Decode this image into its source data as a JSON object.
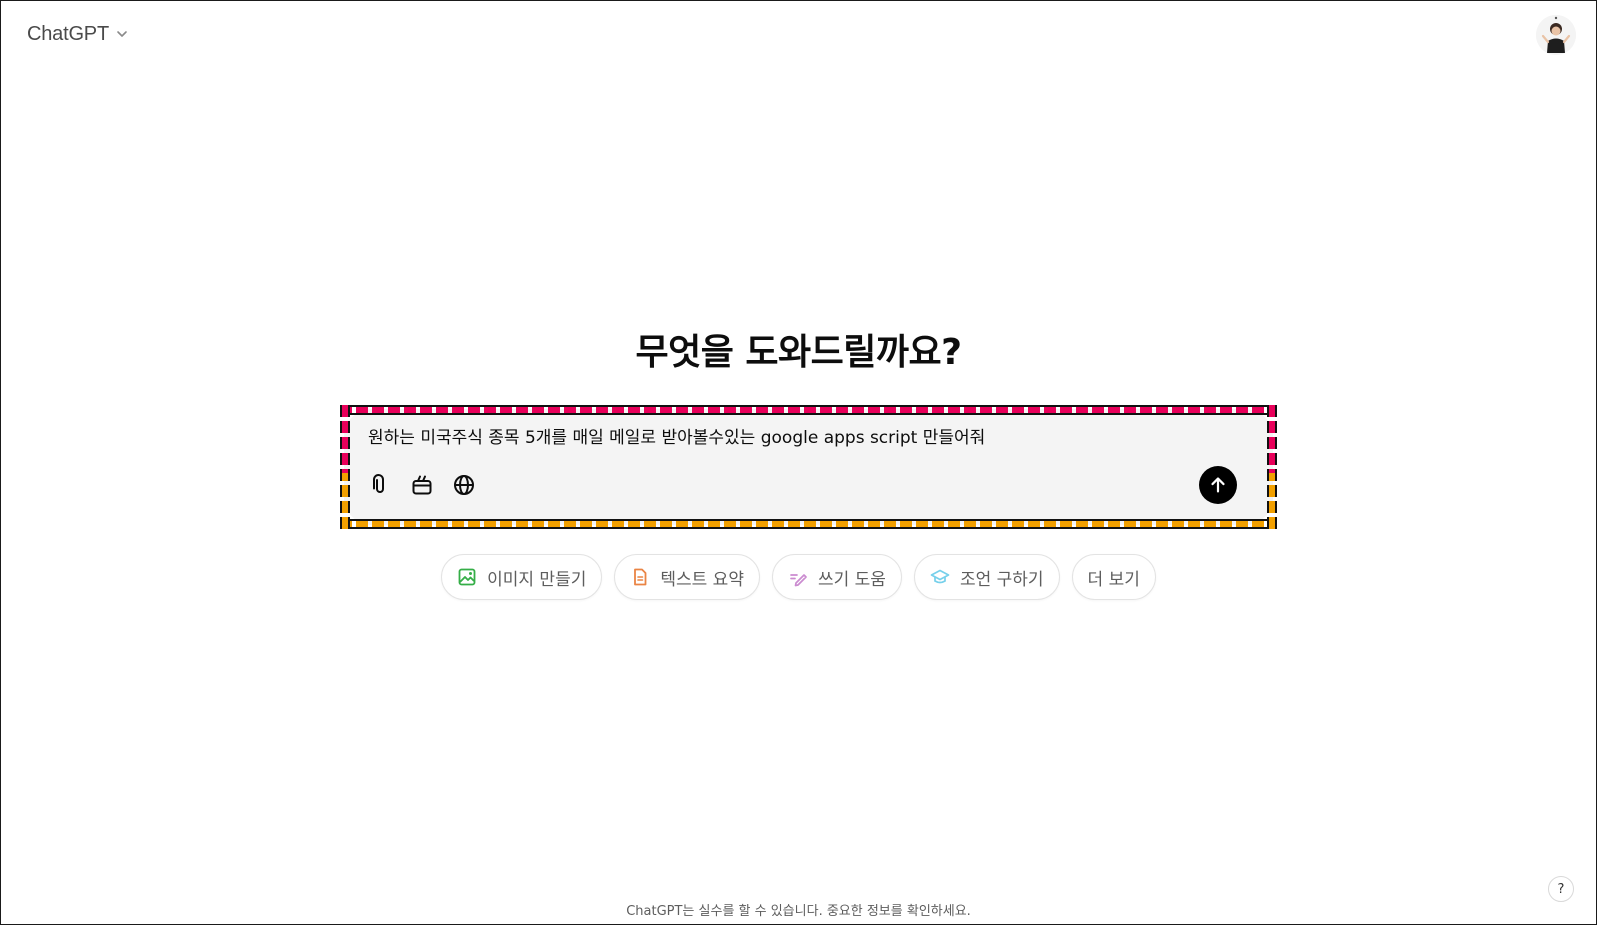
{
  "header": {
    "model_name": "ChatGPT",
    "model_switcher_icon": "chevron-down-icon",
    "avatar_icon": "user-avatar"
  },
  "main": {
    "heading": "무엇을 도와드릴까요?",
    "composer": {
      "value": "원하는 미국주식 종목 5개를 매일 메일로 받아볼수있는 google apps script 만들어줘",
      "tools": [
        {
          "icon": "paperclip-icon"
        },
        {
          "icon": "toolbox-icon"
        },
        {
          "icon": "globe-icon"
        }
      ],
      "send_icon": "arrow-up-icon",
      "highlight_colors": {
        "top": "#e8005a",
        "bottom": "#f2a000"
      }
    },
    "suggestions": [
      {
        "label": "이미지 만들기",
        "icon": "image-icon",
        "color": "#35ae47"
      },
      {
        "label": "텍스트 요약",
        "icon": "document-icon",
        "color": "#ea8444"
      },
      {
        "label": "쓰기 도움",
        "icon": "pen-icon",
        "color": "#cb8bd0"
      },
      {
        "label": "조언 구하기",
        "icon": "graduation-cap-icon",
        "color": "#76d0eb"
      },
      {
        "label": "더 보기",
        "icon": "",
        "color": ""
      }
    ]
  },
  "footer": {
    "disclaimer": "ChatGPT는 실수를 할 수 있습니다. 중요한 정보를 확인하세요.",
    "help_label": "?"
  }
}
